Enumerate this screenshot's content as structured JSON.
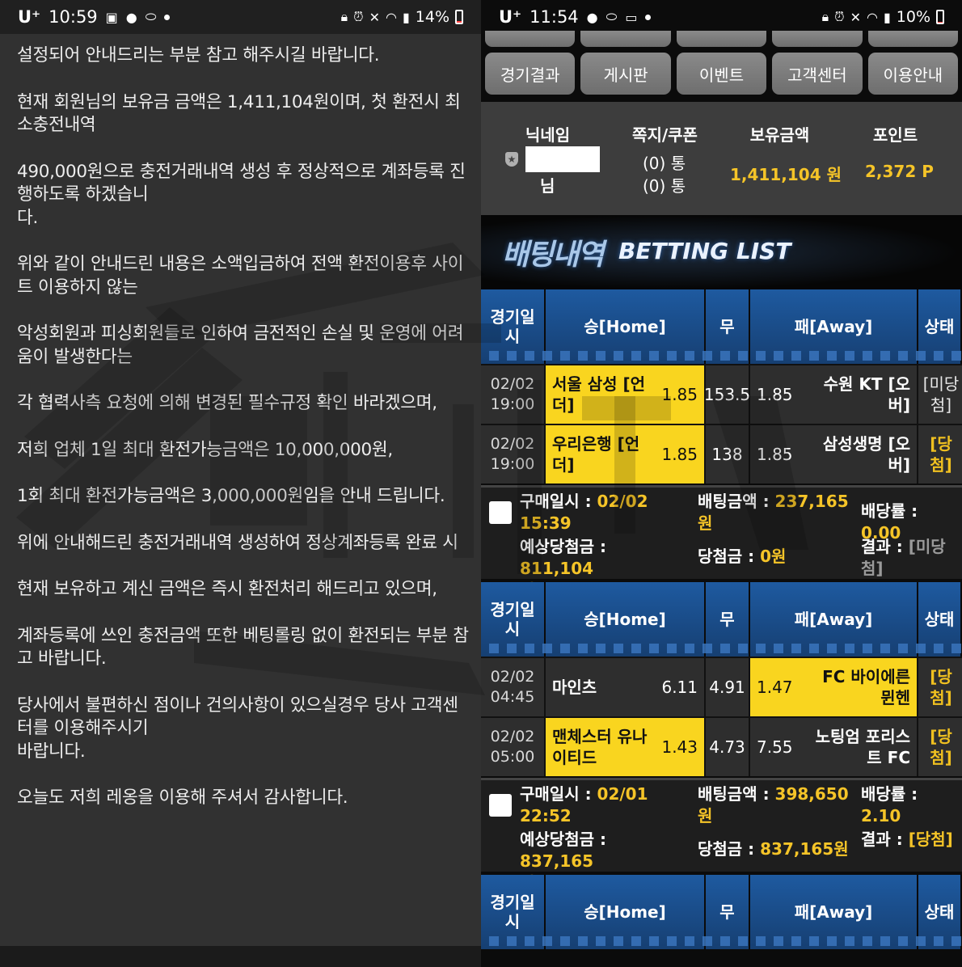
{
  "left": {
    "status": {
      "carrier": "U⁺",
      "time": "10:59",
      "battery": "14%",
      "battery_level": 0.14
    },
    "paragraphs": [
      "설정되어 안내드리는 부분 참고 해주시길 바랍니다.",
      "현재 회원님의 보유금 금액은 1,411,104원이며, 첫 환전시 최소충전내역",
      "490,000원으로 충전거래내역 생성 후 정상적으로 계좌등록 진행하도록 하겠습니\n다.",
      "위와 같이 안내드린 내용은 소액입금하여 전액 환전이용후 사이트 이용하지 않는",
      "악성회원과 피싱회원들로 인하여 금전적인 손실 및 운영에 어려움이 발생한다는",
      "각 협력사측 요청에 의해 변경된 필수규정 확인 바라겠으며,",
      "저희 업체 1일 최대 환전가능금액은 10,000,000원,",
      "1회 최대 환전가능금액은 3,000,000원임을 안내 드립니다.",
      "위에 안내해드린 충전거래내역 생성하여 정상계좌등록 완료 시",
      "현재 보유하고 계신 금액은 즉시 환전처리 해드리고 있으며,",
      "계좌등록에 쓰인 충전금액 또한 베팅롤링 없이 환전되는 부분 참고 바랍니다.",
      "당사에서 불편하신 점이나 건의사항이 있으실경우 당사 고객센터를 이용해주시기\n바랍니다.",
      "오늘도 저희 레옹을 이용해 주셔서 감사합니다."
    ]
  },
  "right": {
    "status": {
      "carrier": "U⁺",
      "time": "11:54",
      "battery": "10%",
      "battery_level": 0.1
    },
    "nav_top": [
      "",
      "",
      "",
      "",
      ""
    ],
    "nav": [
      "경기결과",
      "게시판",
      "이벤트",
      "고객센터",
      "이용안내"
    ],
    "user": {
      "h_nick": "닉네임",
      "h_msg": "쪽지/쿠폰",
      "h_money": "보유금액",
      "h_point": "포인트",
      "nick_suffix": "님",
      "msg1": "(0) 통",
      "msg2": "(0) 통",
      "money": "1,411,104 원",
      "point": "2,372 P"
    },
    "banner": {
      "kr": "배팅내역",
      "en": "BETTING LIST"
    },
    "table_header": {
      "date": "경기일\n시",
      "home": "승[Home]",
      "draw": "무",
      "away": "패[Away]",
      "state": "상태"
    },
    "bets": [
      {
        "rows": [
          {
            "date": "02/02",
            "time": "19:00",
            "home": "서울 삼성 [언\n더]",
            "home_odd": "1.85",
            "draw": "153.5",
            "away_odd": "1.85",
            "away": "수원 KT [오\n버]",
            "state": "[미당\n첨]"
          },
          {
            "date": "02/02",
            "time": "19:00",
            "home": "우리은행 [언\n더]",
            "home_odd": "1.85",
            "draw": "138",
            "away_odd": "1.85",
            "away": "삼성생명 [오\n버]",
            "state": "[당\n첨]"
          }
        ],
        "buy_label": "구매일시 : ",
        "buy_date": "02/02\n15:39",
        "amount_label": "배팅금액 : ",
        "amount": "237,165\n원",
        "ratio_label": "배당률 : ",
        "ratio": "0.00",
        "expected_label": "예상당첨금 : ",
        "expected": "811,104\n원",
        "win_label": "당첨금 : ",
        "win": "0원",
        "result_label": "결과 : ",
        "result": "[미당\n첨]"
      },
      {
        "rows": [
          {
            "date": "02/02",
            "time": "04:45",
            "home": "마인츠",
            "home_odd": "6.11",
            "draw": "4.91",
            "away_odd": "1.47",
            "away": "FC 바이에른\n뮌헨",
            "state": "[당\n첨]"
          },
          {
            "date": "02/02",
            "time": "05:00",
            "home": "맨체스터 유나\n이티드",
            "home_odd": "1.43",
            "draw": "4.73",
            "away_odd": "7.55",
            "away": "노팅엄 포리스\n트 FC",
            "state": "[당\n첨]"
          }
        ],
        "buy_label": "구매일시 : ",
        "buy_date": "02/01\n22:52",
        "amount_label": "배팅금액 : ",
        "amount": "398,650\n원",
        "ratio_label": "배당률 : ",
        "ratio": "2.10",
        "expected_label": "예상당첨금 : ",
        "expected": "837,165\n원",
        "win_label": "당첨금 : ",
        "win": "837,165원",
        "result_label": "결과 : ",
        "result": "[당첨]"
      }
    ]
  },
  "colors": {
    "highlight": "#f9d51f",
    "gold": "#f5c428",
    "header_blue": "#1c4f8e"
  }
}
